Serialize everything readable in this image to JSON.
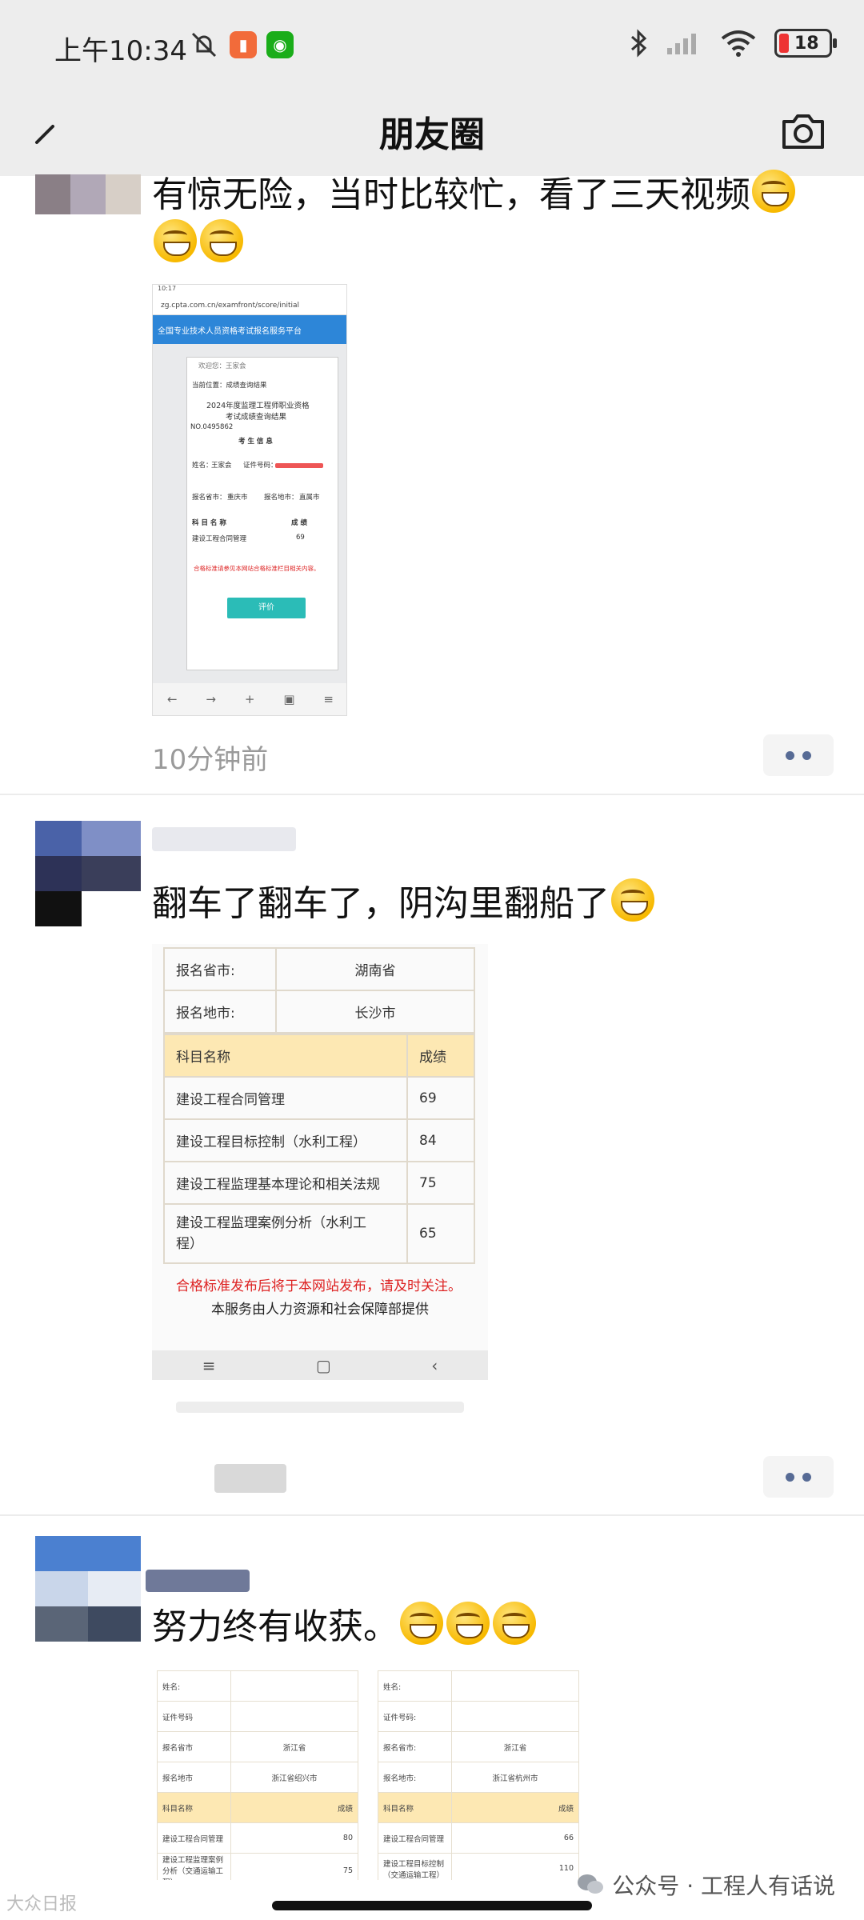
{
  "status_bar": {
    "time": "上午10:34",
    "battery": "18"
  },
  "header": {
    "title": "朋友圈"
  },
  "posts": [
    {
      "text": "有惊无险，当时比较忙，看了三天视频",
      "time": "10分钟前",
      "screenshot": {
        "status": "10:17",
        "url": "zg.cpta.com.cn/examfront/score/initial",
        "banner": "全国专业技术人员资格考试报名服务平台",
        "welcome": "欢迎您：王家会",
        "location": "当前位置：成绩查询结果",
        "title_line1": "2024年度监理工程师职业资格",
        "title_line2": "考试成绩查询结果",
        "number": "NO.0495862",
        "section": "考 生 信 息",
        "name_label": "姓名：",
        "name_value": "王家会",
        "id_label": "证件号码：",
        "province_label": "报名省市：",
        "province_value": "重庆市",
        "city_label": "报名地市：",
        "city_value": "直属市",
        "col_subject": "科 目 名 称",
        "col_score": "成 绩",
        "subject": "建设工程合同管理",
        "score": "69",
        "notice": "合格标准请参见本网站合格标准栏目相关内容。",
        "button": "评价"
      }
    },
    {
      "text": "翻车了翻车了，阴沟里翻船了",
      "table": {
        "rows_top": [
          {
            "label": "报名省市:",
            "value": "湖南省"
          },
          {
            "label": "报名地市:",
            "value": "长沙市"
          }
        ],
        "header": {
          "subject": "科目名称",
          "score": "成绩"
        },
        "rows": [
          {
            "subject": "建设工程合同管理",
            "score": "69"
          },
          {
            "subject": "建设工程目标控制（水利工程）",
            "score": "84"
          },
          {
            "subject": "建设工程监理基本理论和相关法规",
            "score": "75"
          },
          {
            "subject": "建设工程监理案例分析（水利工",
            "subject2": "程）",
            "score": "65"
          }
        ],
        "notice_red": "合格标准发布后将于本网站发布，请及时关注。",
        "notice_black": "本服务由人力资源和社会保障部提供"
      }
    },
    {
      "text": "努力终有收获。",
      "left_table": {
        "labels": [
          "姓名:",
          "证件号码",
          "报名省市",
          "报名地市"
        ],
        "values": [
          "",
          "",
          "浙江省",
          "浙江省绍兴市"
        ],
        "header": {
          "subject": "科目名称",
          "score": "成绩"
        },
        "rows": [
          {
            "subject": "建设工程合同管理",
            "score": "80"
          },
          {
            "subject": "建设工程监理案例分析（交通运输工程）",
            "score": "75"
          }
        ]
      },
      "right_table": {
        "labels": [
          "姓名:",
          "证件号码:",
          "报名省市:",
          "报名地市:"
        ],
        "values": [
          "",
          "",
          "浙江省",
          "浙江省杭州市"
        ],
        "header": {
          "subject": "科目名称",
          "score": "成绩"
        },
        "rows": [
          {
            "subject": "建设工程合同管理",
            "score": "66"
          },
          {
            "subject": "建设工程目标控制（交通运输工程）",
            "score": "110"
          }
        ]
      }
    }
  ],
  "watermark": {
    "left": "大众日报",
    "right": "公众号 · 工程人有话说"
  }
}
